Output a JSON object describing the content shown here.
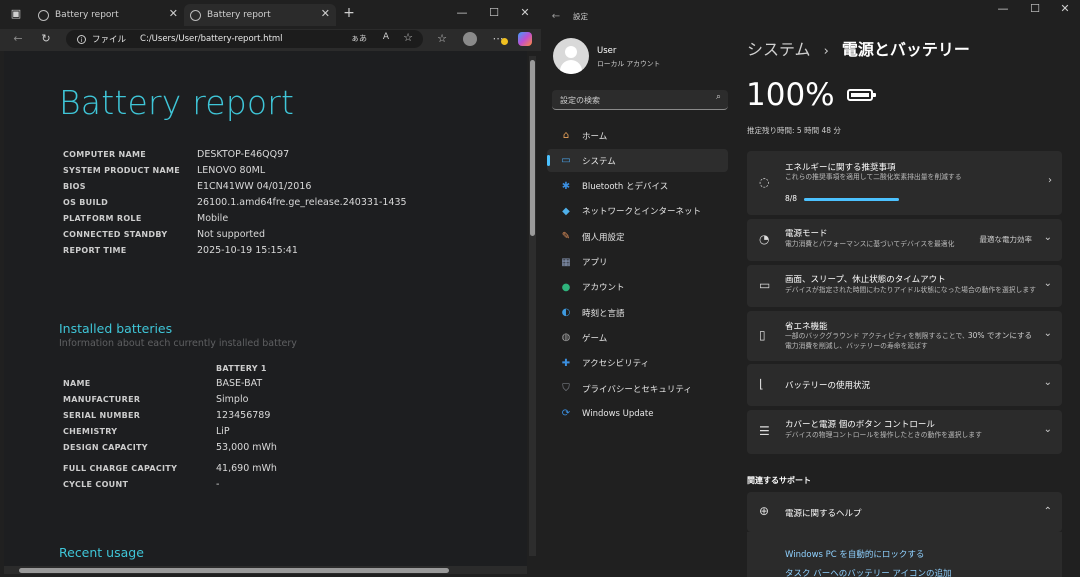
{
  "browser": {
    "tabs": [
      {
        "label": "Battery report"
      },
      {
        "label": "Battery report"
      }
    ],
    "new_tab": "+",
    "address": {
      "prefix": "ファイル",
      "url": "C:/Users/User/battery-report.html"
    },
    "report": {
      "title": "Battery report",
      "system_info": [
        {
          "label": "COMPUTER NAME",
          "value": "DESKTOP-E46QQ97"
        },
        {
          "label": "SYSTEM PRODUCT NAME",
          "value": "LENOVO 80ML"
        },
        {
          "label": "BIOS",
          "value": "E1CN41WW 04/01/2016"
        },
        {
          "label": "OS BUILD",
          "value": "26100.1.amd64fre.ge_release.240331-1435"
        },
        {
          "label": "PLATFORM ROLE",
          "value": "Mobile"
        },
        {
          "label": "CONNECTED STANDBY",
          "value": "Not supported"
        },
        {
          "label": "REPORT TIME",
          "value": "2025-10-19  15:15:41"
        }
      ],
      "installed": {
        "heading": "Installed batteries",
        "subheading": "Information about each currently installed battery",
        "column": "BATTERY 1",
        "rows": [
          {
            "label": "NAME",
            "value": "BASE-BAT"
          },
          {
            "label": "MANUFACTURER",
            "value": "Simplo"
          },
          {
            "label": "SERIAL NUMBER",
            "value": "123456789"
          },
          {
            "label": "CHEMISTRY",
            "value": "LiP"
          },
          {
            "label": "DESIGN CAPACITY",
            "value": "53,000 mWh"
          },
          {
            "label": "FULL CHARGE CAPACITY",
            "value": "41,690 mWh"
          },
          {
            "label": "CYCLE COUNT",
            "value": "-"
          }
        ]
      },
      "recent_heading": "Recent usage"
    }
  },
  "settings": {
    "window_title": "設定",
    "user": {
      "name": "User",
      "account": "ローカル アカウント"
    },
    "search_placeholder": "設定の検索",
    "nav": [
      {
        "label": "ホーム",
        "icon": "home-icon",
        "color": "#e8a25a"
      },
      {
        "label": "システム",
        "icon": "system-icon",
        "color": "#4aa3e8"
      },
      {
        "label": "Bluetooth とデバイス",
        "icon": "bluetooth-icon",
        "color": "#3b8fe0"
      },
      {
        "label": "ネットワークとインターネット",
        "icon": "network-icon",
        "color": "#4fb0ea"
      },
      {
        "label": "個人用設定",
        "icon": "personalize-icon",
        "color": "#e0905a"
      },
      {
        "label": "アプリ",
        "icon": "apps-icon",
        "color": "#8a9ab8"
      },
      {
        "label": "アカウント",
        "icon": "account-icon",
        "color": "#2fb37c"
      },
      {
        "label": "時刻と言語",
        "icon": "time-language-icon",
        "color": "#3f9be0"
      },
      {
        "label": "ゲーム",
        "icon": "gaming-icon",
        "color": "#a0a0a0"
      },
      {
        "label": "アクセシビリティ",
        "icon": "accessibility-icon",
        "color": "#3b8fe0"
      },
      {
        "label": "プライバシーとセキュリティ",
        "icon": "shield-icon",
        "color": "#8a8f98"
      },
      {
        "label": "Windows Update",
        "icon": "windows-update-icon",
        "color": "#3b8fe0"
      }
    ],
    "breadcrumb": {
      "parent": "システム",
      "separator": "›",
      "current": "電源とバッテリー"
    },
    "battery": {
      "percent": "100%",
      "level": 1.0,
      "remaining": "推定残り時間: 5 時間 48 分"
    },
    "cards": [
      {
        "title": "エネルギーに関する推奨事項",
        "desc": "これらの推奨事項を適用して二酸化炭素排出量を削減する",
        "progress_text": "8/8",
        "progress": 1.0,
        "right": "",
        "chevron": "›"
      },
      {
        "title": "電源モード",
        "desc": "電力消費とパフォーマンスに基づいてデバイスを最適化",
        "right": "最適な電力効率",
        "chevron": "⌄"
      },
      {
        "title": "画面、スリープ、休止状態のタイムアウト",
        "desc": "デバイスが指定された時間にわたりアイドル状態になった場合の動作を選択します",
        "right": "",
        "chevron": "⌄"
      },
      {
        "title": "省エネ機能",
        "desc": "一部のバックグラウンド アクティビティを制限することで、電力消費を削減し、バッテリーの寿命を延ばす",
        "right": "30% でオンにする",
        "chevron": "⌄"
      },
      {
        "title": "バッテリーの使用状況",
        "desc": "",
        "right": "",
        "chevron": "⌄"
      },
      {
        "title": "カバーと電源 個のボタン コントロール",
        "desc": "デバイスの物理コントロールを操作したときの動作を選択します",
        "right": "",
        "chevron": "⌄"
      }
    ],
    "related": {
      "heading": "関連するサポート",
      "help_title": "電源に関するヘルプ",
      "chevron": "⌃",
      "links": [
        "Windows PC を自動的にロックする",
        "タスク バーへのバッテリー アイコンの追加"
      ]
    }
  }
}
